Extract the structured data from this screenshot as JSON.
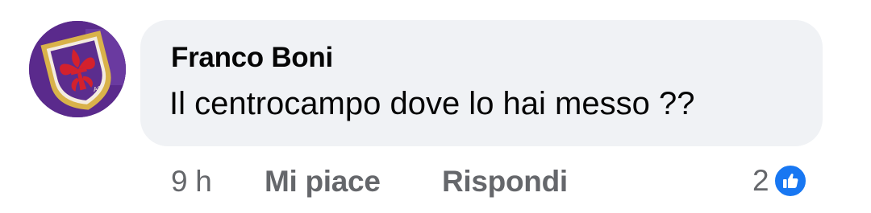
{
  "comment": {
    "author": "Franco Boni",
    "text": "Il centrocampo dove lo hai messo ??",
    "avatar_icon": "fiorentina-lily-crest-icon"
  },
  "actions": {
    "timestamp": "9 h",
    "like_label": "Mi piace",
    "reply_label": "Rispondi"
  },
  "reactions": {
    "count": "2",
    "icon": "like-thumb-icon",
    "color": "#1877f2"
  },
  "colors": {
    "bubble": "#f0f2f5",
    "text": "#050505",
    "secondary_text": "#65676b"
  }
}
